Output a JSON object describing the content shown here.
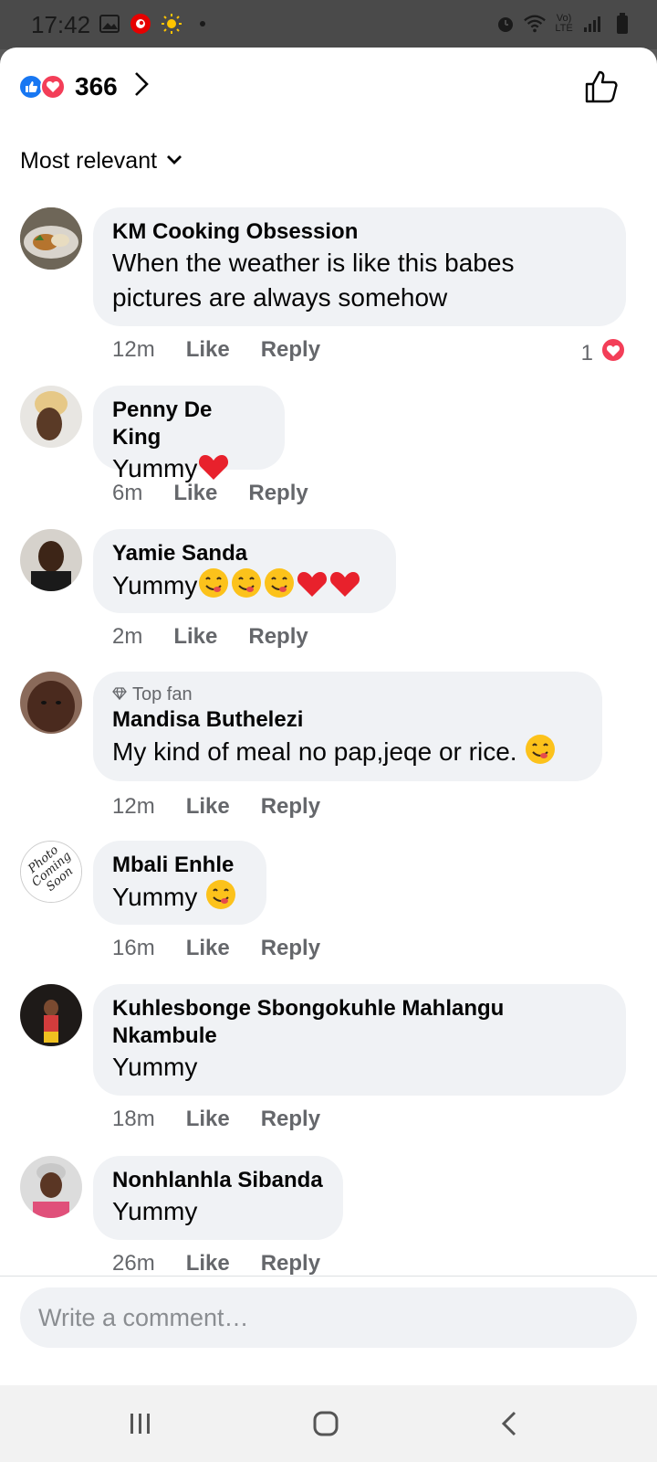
{
  "status_bar": {
    "time": "17:42",
    "network_label": "Vo) LTE"
  },
  "header": {
    "reaction_count": "366"
  },
  "sort": {
    "label": "Most relevant"
  },
  "comments": [
    {
      "name": "KM Cooking Obsession",
      "text_line1": "When the weather is like this babes",
      "text_line2": "pictures are always somehow",
      "time": "12m",
      "like": "Like",
      "reply": "Reply",
      "reaction_count": "1"
    },
    {
      "name": "Penny De King",
      "text": "Yummy",
      "time": "6m",
      "like": "Like",
      "reply": "Reply"
    },
    {
      "name": "Yamie Sanda",
      "text": "Yummy",
      "time": "2m",
      "like": "Like",
      "reply": "Reply"
    },
    {
      "badge": "Top fan",
      "name": "Mandisa Buthelezi",
      "text": "My kind of meal no pap,jeqe or rice.",
      "time": "12m",
      "like": "Like",
      "reply": "Reply"
    },
    {
      "name": "Mbali Enhle",
      "text": "Yummy",
      "time": "16m",
      "like": "Like",
      "reply": "Reply",
      "avatar_text": "Photo Coming Soon"
    },
    {
      "name_line1": "Kuhlesbonge Sbongokuhle Mahlangu",
      "name_line2": "Nkambule",
      "text": "Yummy",
      "time": "18m",
      "like": "Like",
      "reply": "Reply"
    },
    {
      "name": "Nonhlanhla Sibanda",
      "text": "Yummy",
      "time": "26m",
      "like": "Like",
      "reply": "Reply"
    }
  ],
  "composer": {
    "placeholder": "Write a comment…"
  },
  "colors": {
    "like_blue": "#1877f2",
    "love_red": "#f33e58",
    "bubble_bg": "#f0f2f5",
    "meta_gray": "#65676b"
  }
}
